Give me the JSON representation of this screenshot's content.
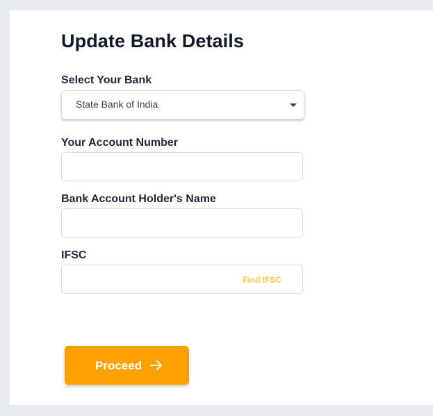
{
  "form": {
    "title": "Update Bank Details",
    "bank": {
      "label": "Select Your Bank",
      "selected": "State Bank of India"
    },
    "account_number": {
      "label": "Your Account Number",
      "value": ""
    },
    "holder_name": {
      "label": "Bank Account Holder's Name",
      "value": ""
    },
    "ifsc": {
      "label": "IFSC",
      "value": "",
      "find_link": "Find IFSC"
    },
    "proceed": {
      "label": "Proceed",
      "icon": "arrow-right-icon"
    }
  },
  "colors": {
    "page_background": "#e9edf0",
    "card_background": "#ffffff",
    "accent": "#fca100",
    "link": "#f8c64a",
    "text": "#1f2937"
  }
}
